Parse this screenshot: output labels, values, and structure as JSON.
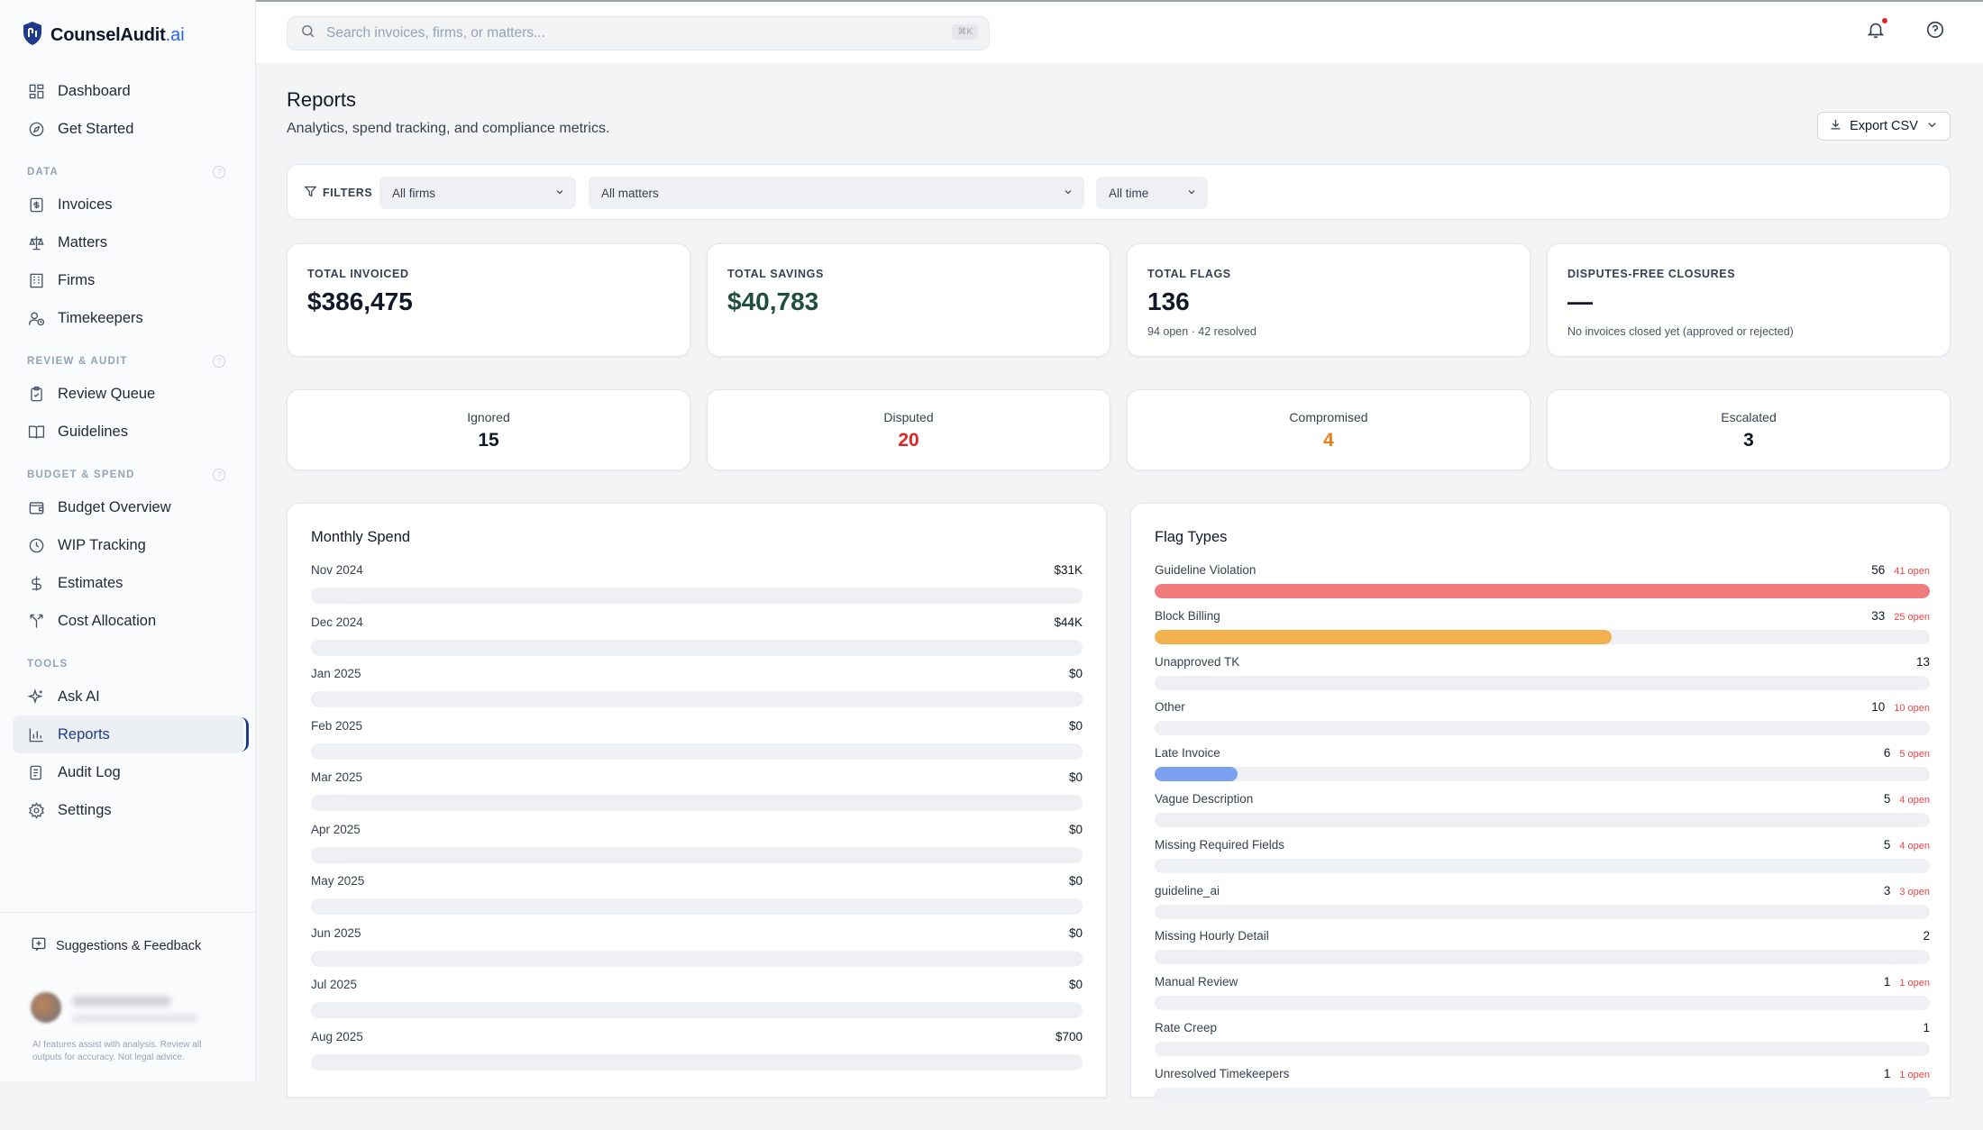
{
  "app": {
    "logo_name": "CounselAudit",
    "logo_suffix": ".ai"
  },
  "sidebar": {
    "items_top": [
      {
        "label": "Dashboard",
        "icon": "grid-icon"
      },
      {
        "label": "Get Started",
        "icon": "compass-icon"
      }
    ],
    "sections": [
      {
        "title": "DATA",
        "items": [
          {
            "label": "Invoices",
            "icon": "dollar-doc-icon"
          },
          {
            "label": "Matters",
            "icon": "scale-icon"
          },
          {
            "label": "Firms",
            "icon": "building-icon"
          },
          {
            "label": "Timekeepers",
            "icon": "user-clock-icon"
          }
        ]
      },
      {
        "title": "REVIEW & AUDIT",
        "items": [
          {
            "label": "Review Queue",
            "icon": "clipboard-icon"
          },
          {
            "label": "Guidelines",
            "icon": "book-icon"
          }
        ]
      },
      {
        "title": "BUDGET & SPEND",
        "items": [
          {
            "label": "Budget Overview",
            "icon": "wallet-icon"
          },
          {
            "label": "WIP Tracking",
            "icon": "clock-icon"
          },
          {
            "label": "Estimates",
            "icon": "dollar-icon"
          },
          {
            "label": "Cost Allocation",
            "icon": "split-icon"
          }
        ]
      },
      {
        "title": "TOOLS",
        "items": [
          {
            "label": "Ask AI",
            "icon": "sparkle-icon"
          },
          {
            "label": "Reports",
            "icon": "bar-chart-icon",
            "active": true
          },
          {
            "label": "Audit Log",
            "icon": "log-icon"
          },
          {
            "label": "Settings",
            "icon": "gear-icon"
          }
        ]
      }
    ],
    "feedback_label": "Suggestions & Feedback",
    "disclaimer": "AI features assist with analysis. Review all outputs for accuracy. Not legal advice."
  },
  "topbar": {
    "search_placeholder": "Search invoices, firms, or matters...",
    "search_shortcut": "⌘K"
  },
  "page": {
    "title": "Reports",
    "subtitle": "Analytics, spend tracking, and compliance metrics.",
    "export_label": "Export CSV"
  },
  "filters": {
    "label": "FILTERS",
    "firm": "All firms",
    "matter": "All matters",
    "time": "All time"
  },
  "kpis": [
    {
      "label": "TOTAL INVOICED",
      "value": "$386,475",
      "sub": ""
    },
    {
      "label": "TOTAL SAVINGS",
      "value": "$40,783",
      "sub": ""
    },
    {
      "label": "TOTAL FLAGS",
      "value": "136",
      "sub": "94 open · 42 resolved"
    },
    {
      "label": "DISPUTES-FREE CLOSURES",
      "value": "—",
      "sub": "No invoices closed yet (approved or rejected)"
    }
  ],
  "statuses": [
    {
      "label": "Ignored",
      "value": "15",
      "color": "#111827"
    },
    {
      "label": "Disputed",
      "value": "20",
      "color": "#dc2626"
    },
    {
      "label": "Compromised",
      "value": "4",
      "color": "#ea7a12"
    },
    {
      "label": "Escalated",
      "value": "3",
      "color": "#111827"
    }
  ],
  "monthly_spend": {
    "title": "Monthly Spend",
    "rows": [
      {
        "month": "Nov 2024",
        "value": "$31K",
        "fraction": 0
      },
      {
        "month": "Dec 2024",
        "value": "$44K",
        "fraction": 0
      },
      {
        "month": "Jan 2025",
        "value": "$0",
        "fraction": 0
      },
      {
        "month": "Feb 2025",
        "value": "$0",
        "fraction": 0
      },
      {
        "month": "Mar 2025",
        "value": "$0",
        "fraction": 0
      },
      {
        "month": "Apr 2025",
        "value": "$0",
        "fraction": 0
      },
      {
        "month": "May 2025",
        "value": "$0",
        "fraction": 0
      },
      {
        "month": "Jun 2025",
        "value": "$0",
        "fraction": 0
      },
      {
        "month": "Jul 2025",
        "value": "$0",
        "fraction": 0
      },
      {
        "month": "Aug 2025",
        "value": "$700",
        "fraction": 0
      }
    ]
  },
  "flag_types": {
    "title": "Flag Types",
    "rows": [
      {
        "name": "Guideline Violation",
        "count": "56",
        "open": "41 open",
        "fraction": 1.0,
        "color": "#ef7b7b"
      },
      {
        "name": "Block Billing",
        "count": "33",
        "open": "25 open",
        "fraction": 0.589,
        "color": "#f0b14e"
      },
      {
        "name": "Unapproved TK",
        "count": "13",
        "open": "",
        "fraction": 0,
        "color": ""
      },
      {
        "name": "Other",
        "count": "10",
        "open": "10 open",
        "fraction": 0,
        "color": ""
      },
      {
        "name": "Late Invoice",
        "count": "6",
        "open": "5 open",
        "fraction": 0.107,
        "color": "#7ba0f0"
      },
      {
        "name": "Vague Description",
        "count": "5",
        "open": "4 open",
        "fraction": 0,
        "color": ""
      },
      {
        "name": "Missing Required Fields",
        "count": "5",
        "open": "4 open",
        "fraction": 0,
        "color": ""
      },
      {
        "name": "guideline_ai",
        "count": "3",
        "open": "3 open",
        "fraction": 0,
        "color": ""
      },
      {
        "name": "Missing Hourly Detail",
        "count": "2",
        "open": "",
        "fraction": 0,
        "color": ""
      },
      {
        "name": "Manual Review",
        "count": "1",
        "open": "1 open",
        "fraction": 0,
        "color": ""
      },
      {
        "name": "Rate Creep",
        "count": "1",
        "open": "",
        "fraction": 0,
        "color": ""
      },
      {
        "name": "Unresolved Timekeepers",
        "count": "1",
        "open": "1 open",
        "fraction": 0,
        "color": ""
      }
    ]
  }
}
